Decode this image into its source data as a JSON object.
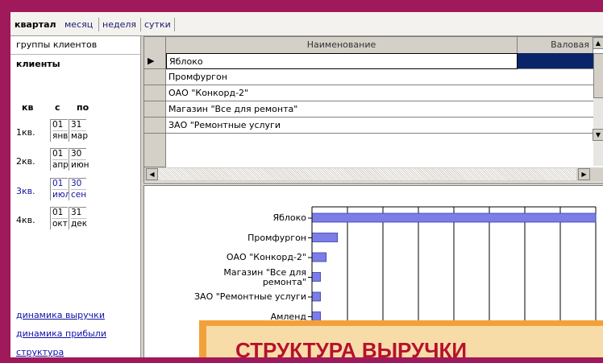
{
  "tabs": [
    "квартал",
    "месяц",
    "неделя",
    "сутки"
  ],
  "left": {
    "groups_label": "группы клиентов",
    "clients_label": "клиенты",
    "col_kv": "кв",
    "col_from": "с",
    "col_to": "по",
    "quarters": [
      {
        "label": "1кв.",
        "from_day": "01",
        "from_month": "янв",
        "to_day": "31",
        "to_month": "мар"
      },
      {
        "label": "2кв.",
        "from_day": "01",
        "from_month": "апр",
        "to_day": "30",
        "to_month": "июн"
      },
      {
        "label": "3кв.",
        "from_day": "01",
        "from_month": "июл",
        "to_day": "30",
        "to_month": "сен"
      },
      {
        "label": "4кв.",
        "from_day": "01",
        "from_month": "окт",
        "to_day": "31",
        "to_month": "дек"
      }
    ],
    "links": [
      "динамика выручки",
      "динамика прибыли",
      "структура"
    ]
  },
  "grid": {
    "col_name": "Наименование",
    "col_gross": "Валовая",
    "rows": [
      "Яблоко",
      "Промфургон",
      "ОАО \"Конкорд-2\"",
      "Магазин \"Все для ремонта\"",
      "ЗАО \"Ремонтные услуги"
    ]
  },
  "chart_data": {
    "type": "bar",
    "orientation": "horizontal",
    "categories": [
      "Яблоко",
      "Промфургон",
      "ОАО \"Конкорд-2\"",
      "Магазин \"Все для ремонта\"",
      "ЗАО \"Ремонтные услуги",
      "Амленд"
    ],
    "category_label_lines": [
      [
        "Яблоко"
      ],
      [
        "Промфургон"
      ],
      [
        "ОАО \"Конкорд-2\""
      ],
      [
        "Магазин \"Все для",
        "ремонта\""
      ],
      [
        "ЗАО \"Ремонтные услуги"
      ],
      [
        "Амленд"
      ]
    ],
    "values": [
      100,
      9,
      5,
      3,
      3,
      3
    ],
    "xlim": [
      0,
      100
    ],
    "grid": true,
    "bar_color": "#7b7ee6"
  },
  "banner": {
    "text": "СТРУКТУРА ВЫРУЧКИ"
  },
  "colors": {
    "background": "#a0195a",
    "accent": "#1212a8",
    "banner_text": "#b5122e"
  }
}
